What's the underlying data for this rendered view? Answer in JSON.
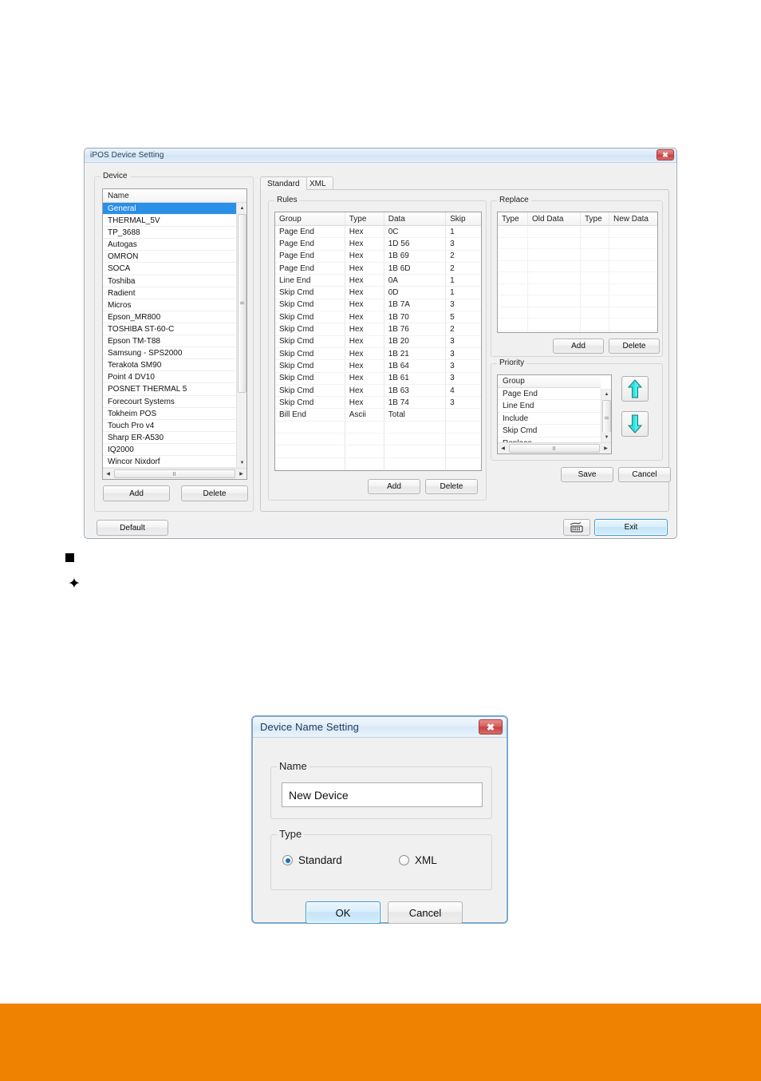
{
  "main_dialog": {
    "title": "iPOS Device Setting",
    "close_label": "✖",
    "device_group": {
      "label": "Device",
      "column_header": "Name",
      "items": [
        "General",
        "THERMAL_5V",
        "TP_3688",
        "Autogas",
        "OMRON",
        "SOCA",
        "Toshiba",
        "Radient",
        "Micros",
        "Epson_MR800",
        "TOSHIBA ST-60-C",
        "Epson TM-T88",
        "Samsung - SPS2000",
        "Terakota SM90",
        "Point 4 DV10",
        "POSNET THERMAL 5",
        "Forecourt Systems",
        "Tokheim POS",
        "Touch Pro v4",
        "Sharp ER-A530",
        "IQ2000",
        "Wincor Nixdorf"
      ],
      "selected": "General",
      "add_label": "Add",
      "delete_label": "Delete"
    },
    "tabs": [
      {
        "label": "Standard",
        "active": true
      },
      {
        "label": "XML",
        "active": false
      }
    ],
    "rules": {
      "label": "Rules",
      "columns": [
        "Group",
        "Type",
        "Data",
        "Skip"
      ],
      "rows": [
        [
          "Page End",
          "Hex",
          "0C",
          "1"
        ],
        [
          "Page End",
          "Hex",
          "1D 56",
          "3"
        ],
        [
          "Page End",
          "Hex",
          "1B 69",
          "2"
        ],
        [
          "Page End",
          "Hex",
          "1B 6D",
          "2"
        ],
        [
          "Line End",
          "Hex",
          "0A",
          "1"
        ],
        [
          "Skip Cmd",
          "Hex",
          "0D",
          "1"
        ],
        [
          "Skip Cmd",
          "Hex",
          "1B 7A",
          "3"
        ],
        [
          "Skip Cmd",
          "Hex",
          "1B 70",
          "5"
        ],
        [
          "Skip Cmd",
          "Hex",
          "1B 76",
          "2"
        ],
        [
          "Skip Cmd",
          "Hex",
          "1B 20",
          "3"
        ],
        [
          "Skip Cmd",
          "Hex",
          "1B 21",
          "3"
        ],
        [
          "Skip Cmd",
          "Hex",
          "1B 64",
          "3"
        ],
        [
          "Skip Cmd",
          "Hex",
          "1B 61",
          "3"
        ],
        [
          "Skip Cmd",
          "Hex",
          "1B 63",
          "4"
        ],
        [
          "Skip Cmd",
          "Hex",
          "1B 74",
          "3"
        ],
        [
          "Bill End",
          "Ascii",
          "Total",
          ""
        ]
      ],
      "add_label": "Add",
      "delete_label": "Delete"
    },
    "replace": {
      "label": "Replace",
      "columns": [
        "Type",
        "Old Data",
        "Type",
        "New Data"
      ],
      "rows": [],
      "add_label": "Add",
      "delete_label": "Delete"
    },
    "priority": {
      "label": "Priority",
      "column_header": "Group",
      "items": [
        "Page End",
        "Line End",
        "Include",
        "Skip Cmd",
        "Replace"
      ],
      "up_icon": "arrow-up-icon",
      "down_icon": "arrow-down-icon"
    },
    "save_label": "Save",
    "cancel_label": "Cancel",
    "default_label": "Default",
    "keypad_icon": "keypad-icon",
    "exit_label": "Exit"
  },
  "markers": {
    "square_bullet": "■",
    "sparkle": "✦"
  },
  "name_dialog": {
    "title": "Device Name Setting",
    "close_label": "✖",
    "name_group_label": "Name",
    "name_value": "New Device",
    "type_group_label": "Type",
    "type_options": [
      {
        "label": "Standard",
        "checked": true
      },
      {
        "label": "XML",
        "checked": false
      }
    ],
    "ok_label": "OK",
    "cancel_label": "Cancel"
  },
  "colors": {
    "footer_orange": "#ef8200",
    "selection_blue": "#2a8fe6",
    "arrow_cyan": "#2ee0e0"
  }
}
